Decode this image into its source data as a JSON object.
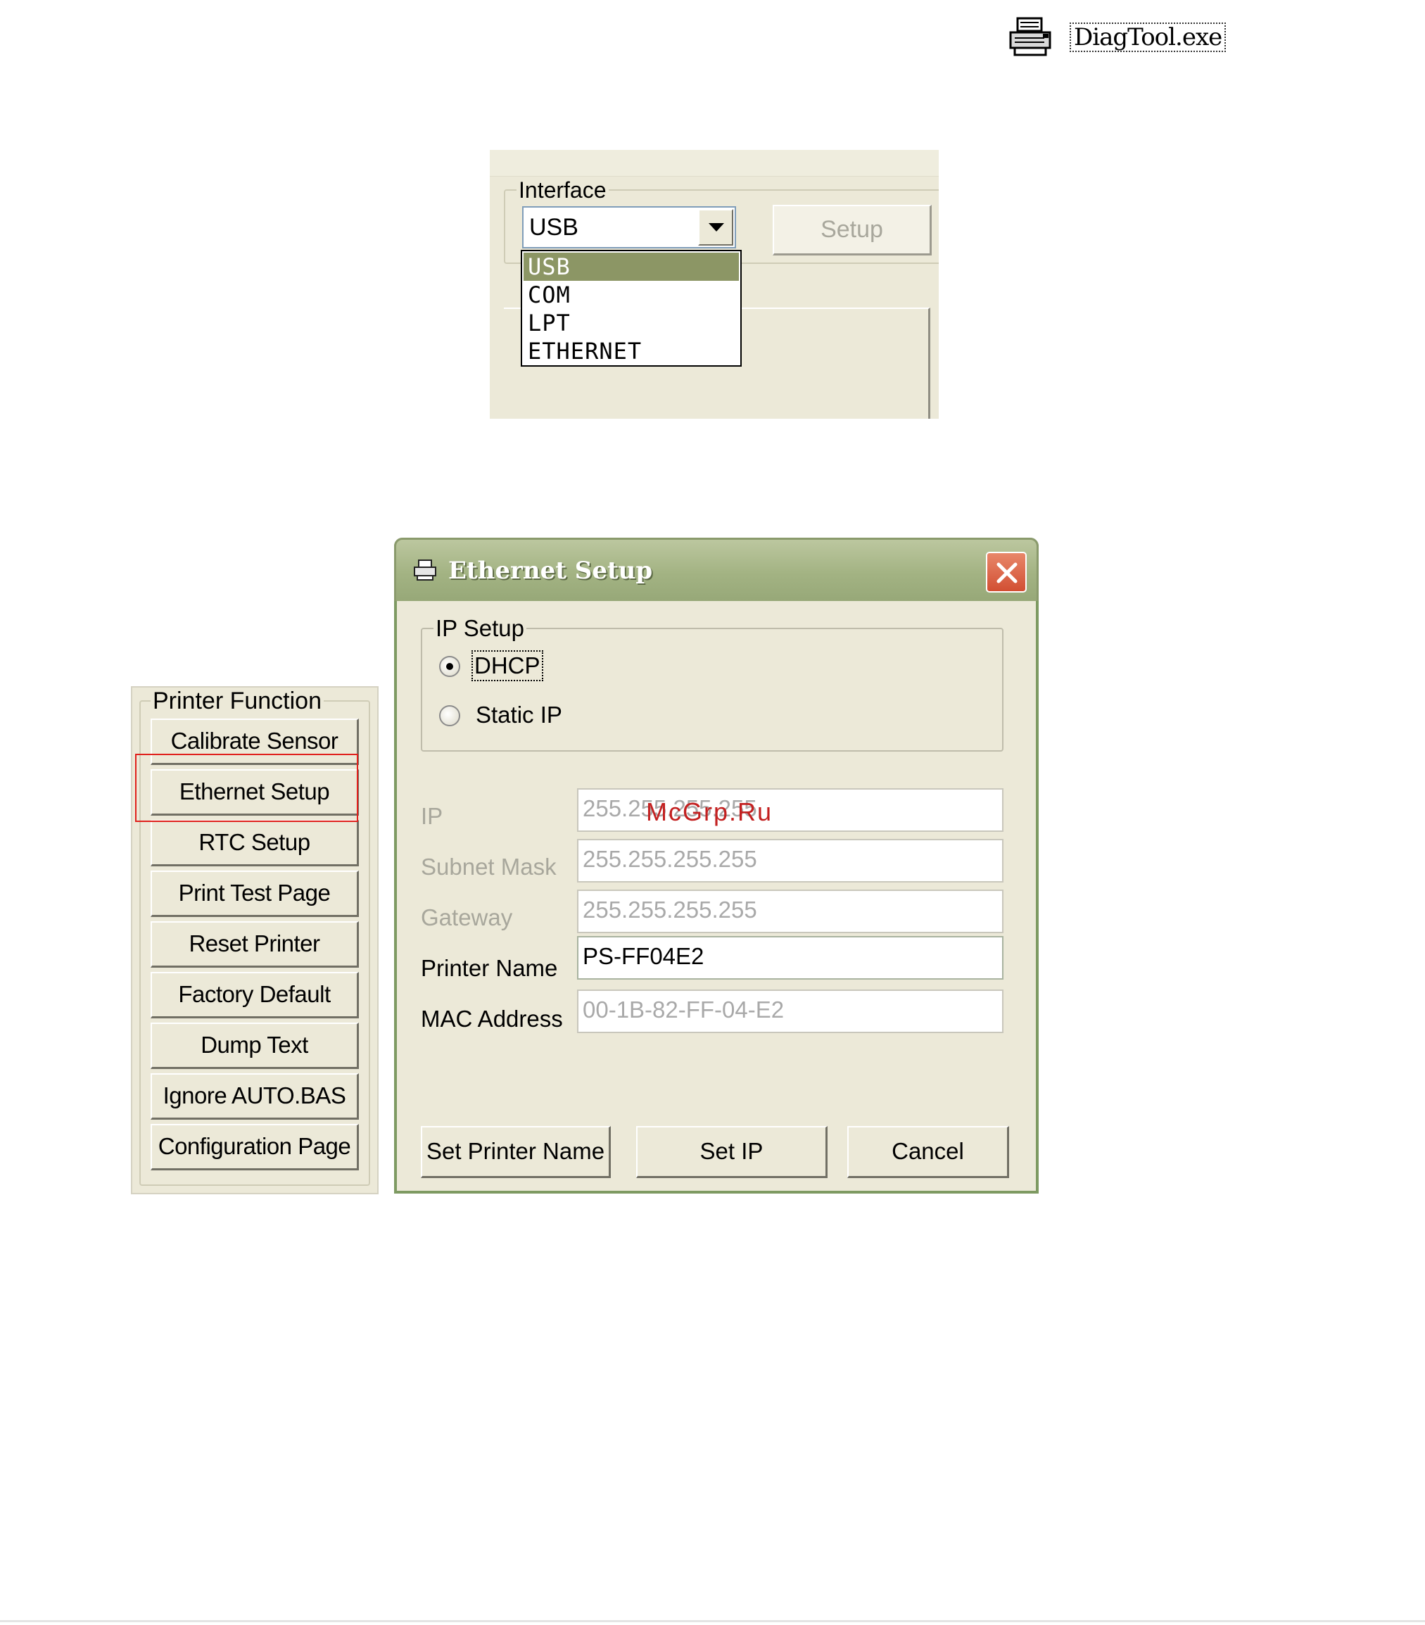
{
  "shortcut": {
    "icon": "printer-icon",
    "filename": "DiagTool.exe"
  },
  "interface_panel": {
    "group_label": "Interface",
    "selected_value": "USB",
    "setup_label": "Setup",
    "options": [
      "USB",
      "COM",
      "LPT",
      "ETHERNET"
    ],
    "highlighted_option": "USB",
    "highlight_color": "#8c9665"
  },
  "printer_function": {
    "group_label": "Printer Function",
    "buttons": [
      "Calibrate Sensor",
      "Ethernet Setup",
      "RTC Setup",
      "Print Test Page",
      "Reset Printer",
      "Factory Default",
      "Dump Text",
      "Ignore AUTO.BAS",
      "Configuration Page"
    ],
    "highlighted_button": "Ethernet Setup",
    "highlight_color": "#e0201c"
  },
  "ethernet_dialog": {
    "title": "Ethernet Setup",
    "title_icon": "printer-icon",
    "close_icon": "close-icon",
    "ip_setup": {
      "label": "IP Setup",
      "dhcp_label": "DHCP",
      "static_label": "Static IP",
      "selected": "DHCP"
    },
    "fields": {
      "ip": {
        "label": "IP",
        "value": "255.255.255.255"
      },
      "subnet": {
        "label": "Subnet Mask",
        "value": "255.255.255.255"
      },
      "gateway": {
        "label": "Gateway",
        "value": "255.255.255.255"
      },
      "printer_name": {
        "label": "Printer Name",
        "value": "PS-FF04E2"
      },
      "mac": {
        "label": "MAC Address",
        "value": "00-1B-82-FF-04-E2"
      }
    },
    "buttons": {
      "set_printer_name": "Set Printer Name",
      "set_ip": "Set IP",
      "cancel": "Cancel"
    },
    "titlebar_color": "#a3b383"
  },
  "watermark": "McGrp.Ru"
}
